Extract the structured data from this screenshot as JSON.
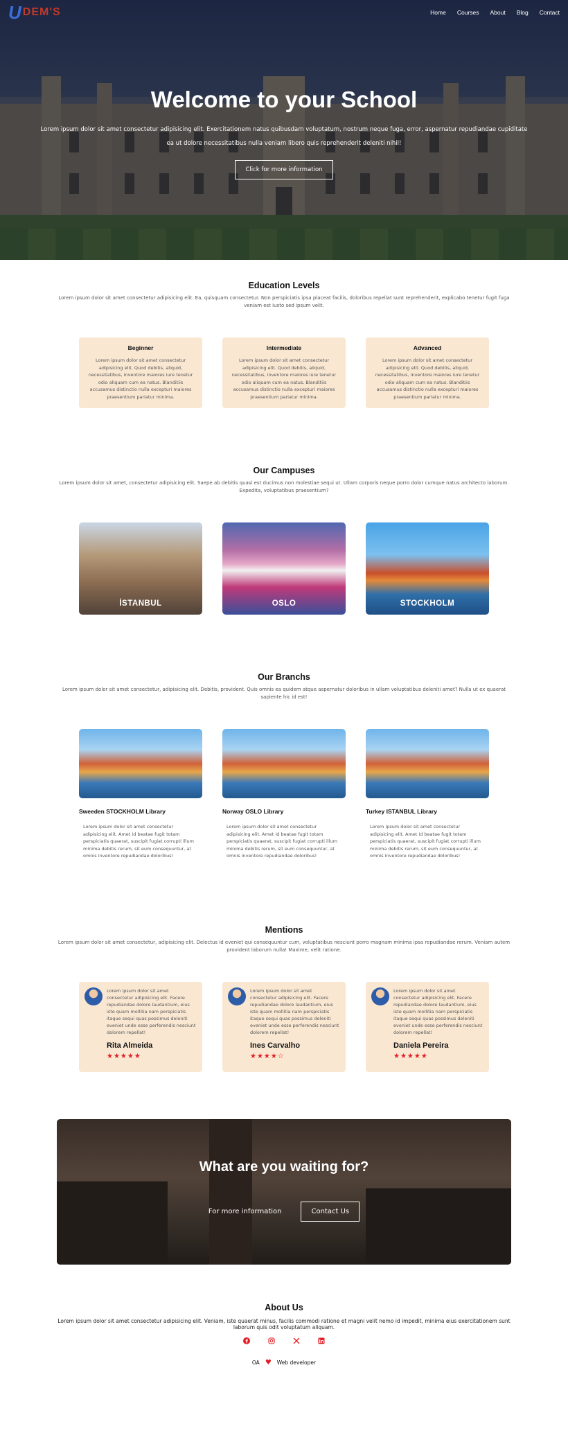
{
  "nav": {
    "logo": "DEM'S",
    "links": [
      "Home",
      "Courses",
      "About",
      "Blog",
      "Contact"
    ]
  },
  "hero": {
    "title": "Welcome to your School",
    "text": "Lorem ipsum dolor sit amet consectetur adipisicing elit. Exercitationem natus quibusdam voluptatum, nostrum neque fuga, error, aspernatur repudiandae cupiditate ea ut dolore necessitatibus nulla veniam libero quis reprehenderit deleniti nihil!",
    "button": "Click for more information"
  },
  "levels": {
    "title": "Education Levels",
    "text": "Lorem ipsum dolor sit amet consectetur adipisicing elit. Ea, quisquam consectetur. Non perspiciatis ipsa placeat facilis, doloribus repellat sunt reprehenderit, explicabo tenetur fugit fuga veniam est iusto sed ipsum velit.",
    "items": [
      {
        "title": "Beginner",
        "text": "Lorem ipsum dolor sit amet consectetur adipisicing elit. Quod debitis, aliquid, necessitatibus, inventore maiores iure tenetur odio aliquam cum ea natus. Blanditiis accusamus distinctio nulla excepturi maiores praesentium pariatur minima."
      },
      {
        "title": "Intermediate",
        "text": "Lorem ipsum dolor sit amet consectetur adipisicing elit. Quod debitis, aliquid, necessitatibus, inventore maiores iure tenetur odio aliquam cum ea natus. Blanditiis accusamus distinctio nulla excepturi maiores praesentium pariatur minima."
      },
      {
        "title": "Advanced",
        "text": "Lorem ipsum dolor sit amet consectetur adipisicing elit. Quod debitis, aliquid, necessitatibus, inventore maiores iure tenetur odio aliquam cum ea natus. Blanditiis accusamus distinctio nulla excepturi maiores praesentium pariatur minima."
      }
    ]
  },
  "campuses": {
    "title": "Our Campuses",
    "text": "Lorem ipsum dolor sit amet, consectetur adipisicing elit. Saepe ab debitis quasi est ducimus non molestiae sequi ut. Ullam corporis neque porro dolor cumque natus architecto laborum. Expedita, voluptatibus praesentium?",
    "items": [
      "İSTANBUL",
      "OSLO",
      "STOCKHOLM"
    ]
  },
  "branchs": {
    "title": "Our Branchs",
    "text": "Lorem ipsum dolor sit amet consectetur, adipisicing elit. Debitis, provident. Quis omnis ea quidem atque aspernatur doloribus in ullam voluptatibus deleniti amet? Nulla ut ex quaerat sapiente hic id est!",
    "items": [
      {
        "title": "Sweeden STOCKHOLM Library",
        "text": "Lorem ipsum dolor sit amet consectetur adipisicing elit. Amet id beatae fugit totam perspiciatis quaerat, suscipit fugiat corrupti illum minima debitis rerum, sit eum consequuntur, at omnis inventore repudiandae doloribus!"
      },
      {
        "title": "Norway OSLO Library",
        "text": "Lorem ipsum dolor sit amet consectetur adipisicing elit. Amet id beatae fugit totam perspiciatis quaerat, suscipit fugiat corrupti illum minima debitis rerum, sit eum consequuntur, at omnis inventore repudiandae doloribus!"
      },
      {
        "title": "Turkey ISTANBUL Library",
        "text": "Lorem ipsum dolor sit amet consectetur adipisicing elit. Amet id beatae fugit totam perspiciatis quaerat, suscipit fugiat corrupti illum minima debitis rerum, sit eum consequuntur, at omnis inventore repudiandae doloribus!"
      }
    ]
  },
  "mentions": {
    "title": "Mentions",
    "text": "Lorem ipsum dolor sit amet consectetur, adipisicing elit. Delectus id eveniet qui consequuntur cum, voluptatibus nesciunt porro magnam minima ipsa repudiandae rerum. Veniam autem provident laborum nulla! Maxime, velit ratione.",
    "items": [
      {
        "text": "Lorem ipsum dolor sit amet consectetur adipisicing elit. Facere repudiandae dolore laudantium, eius iste quam mollitia nam perspiciatis itaque sequi quas possimus deleniti eveniet unde esse perferendis nesciunt dolorem repellat!",
        "name": "Rita Almeida",
        "stars": "★★★★★"
      },
      {
        "text": "Lorem ipsum dolor sit amet consectetur adipisicing elit. Facere repudiandae dolore laudantium, eius iste quam mollitia nam perspiciatis itaque sequi quas possimus deleniti eveniet unde esse perferendis nesciunt dolorem repellat!",
        "name": "Ines Carvalho",
        "stars": "★★★★☆"
      },
      {
        "text": "Lorem ipsum dolor sit amet consectetur adipisicing elit. Facere repudiandae dolore laudantium, eius iste quam mollitia nam perspiciatis itaque sequi quas possimus deleniti eveniet unde esse perferendis nesciunt dolorem repellat!",
        "name": "Daniela Pereira",
        "stars": "★★★★★"
      }
    ]
  },
  "cta": {
    "title": "What are you waiting for?",
    "link": "For more information",
    "button": "Contact Us"
  },
  "about": {
    "title": "About Us",
    "text": "Lorem ipsum dolor sit amet consectetur adipisicing elit. Veniam, iste quaerat minus, facilis commodi ratione et magni velit nemo id impedit, minima eius exercitationem sunt laborum quis odit voluptatum aliquam.",
    "socials": [
      "facebook-icon",
      "instagram-icon",
      "x-icon",
      "linkedin-icon"
    ],
    "credit_left": "OA",
    "credit_right": "Web developer"
  },
  "colors": {
    "accent": "#e31b23",
    "card_bg": "#f9e7d2"
  }
}
